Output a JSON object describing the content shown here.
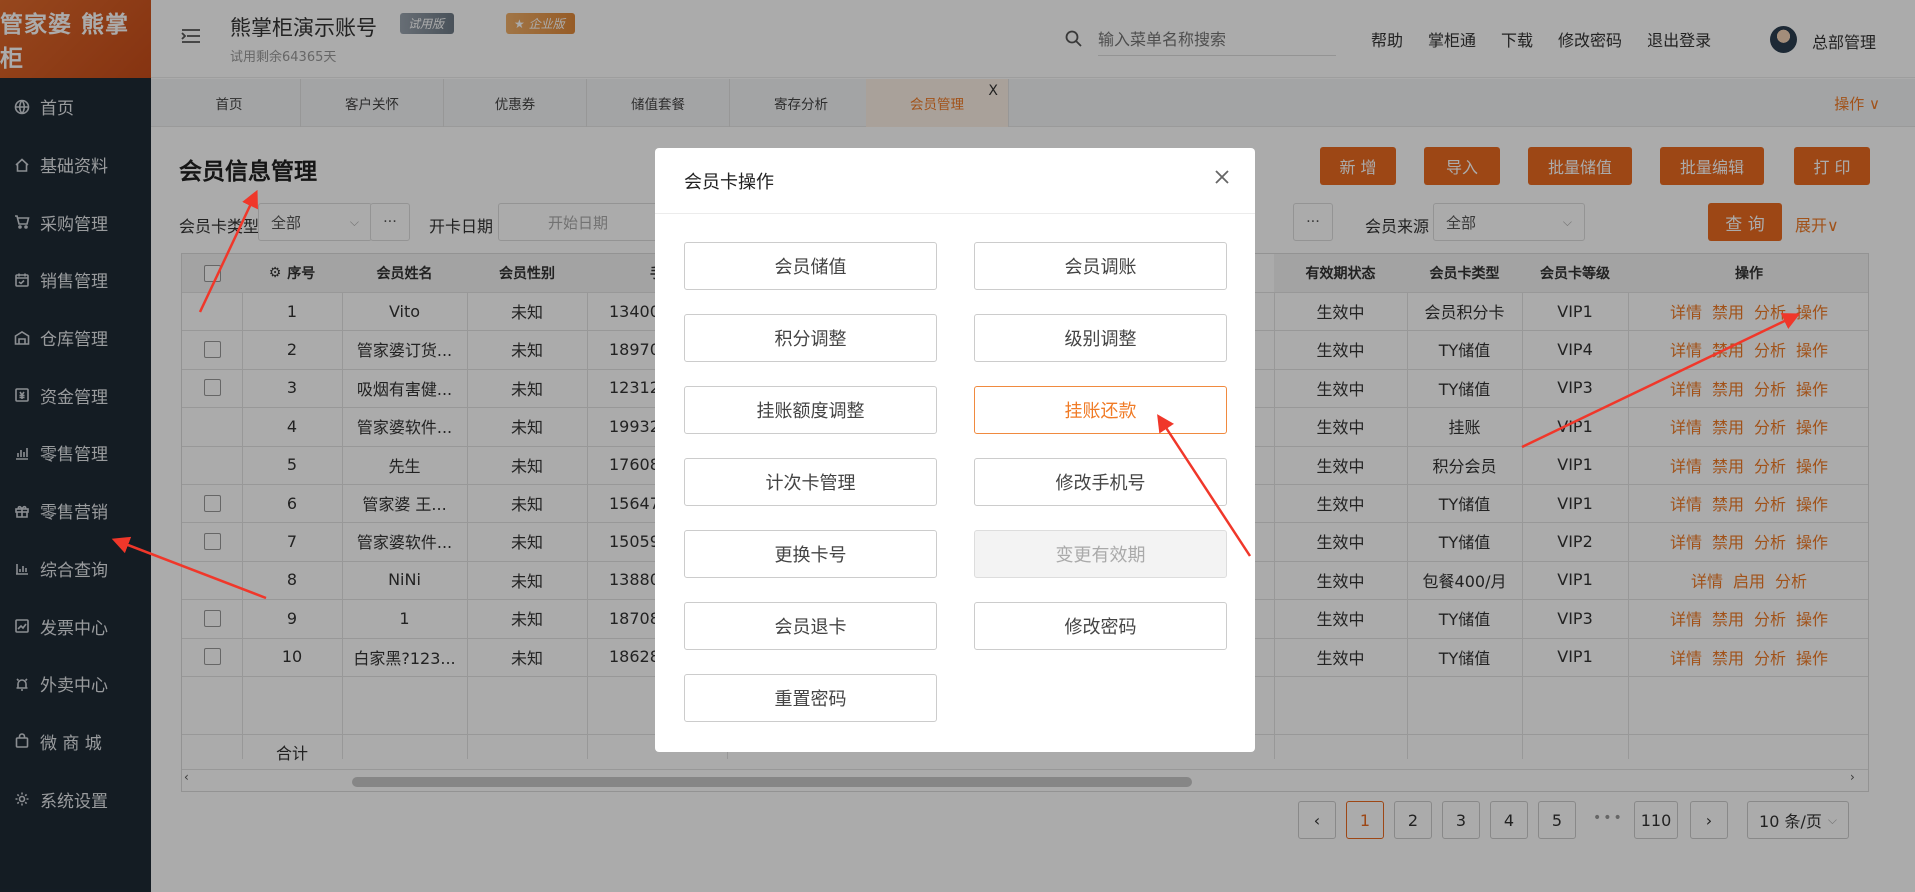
{
  "sidebar": {
    "logo": "管家婆 熊掌柜",
    "items": [
      {
        "label": "首页",
        "icon": "globe-icon"
      },
      {
        "label": "基础资料",
        "icon": "home-icon"
      },
      {
        "label": "采购管理",
        "icon": "cart-icon"
      },
      {
        "label": "销售管理",
        "icon": "calendar-icon"
      },
      {
        "label": "仓库管理",
        "icon": "warehouse-icon"
      },
      {
        "label": "资金管理",
        "icon": "money-icon"
      },
      {
        "label": "零售管理",
        "icon": "bar-chart-icon"
      },
      {
        "label": "零售营销",
        "icon": "gift-icon"
      },
      {
        "label": "综合查询",
        "icon": "stats-icon"
      },
      {
        "label": "发票中心",
        "icon": "line-chart-icon"
      },
      {
        "label": "外卖中心",
        "icon": "alarm-icon"
      },
      {
        "label": "微 商 城",
        "icon": "bag-icon"
      },
      {
        "label": "系统设置",
        "icon": "gear-icon"
      }
    ]
  },
  "header": {
    "title": "熊掌柜演示账号",
    "subtitle": "试用剩余64365天",
    "badge_trial": "试用版",
    "badge_enterprise": "企业版",
    "search_placeholder": "输入菜单名称搜索",
    "links": [
      "帮助",
      "掌柜通",
      "下载",
      "修改密码",
      "退出登录"
    ],
    "user": "总部管理"
  },
  "tabs": {
    "items": [
      "首页",
      "客户关怀",
      "优惠券",
      "储值套餐",
      "寄存分析",
      "会员管理"
    ],
    "active_index": 5,
    "close": "X",
    "operate": "操作 ∨"
  },
  "page": {
    "title": "会员信息管理",
    "buttons": [
      "新 增",
      "导入",
      "批量储值",
      "批量编辑",
      "打 印"
    ],
    "filters": {
      "card_type_label": "会员卡类型",
      "card_type_value": "全部",
      "open_date_label": "开卡日期",
      "start_date_placeholder": "开始日期",
      "source_label": "会员来源",
      "source_value": "全部",
      "more": "···"
    },
    "query": "查 询",
    "expand": "展开∨"
  },
  "table": {
    "headers": {
      "index": "序号",
      "name": "会员姓名",
      "gender": "会员性别",
      "phone": "手",
      "status": "有效期状态",
      "card_type": "会员卡类型",
      "level": "会员卡等级",
      "ops": "操作"
    },
    "rows": [
      {
        "no": "1",
        "name": "Vito",
        "gender": "未知",
        "phone": "13400",
        "status": "生效中",
        "type": "会员积分卡",
        "level": "VIP1",
        "checkbox": false,
        "disabled": false
      },
      {
        "no": "2",
        "name": "管家婆订货...",
        "gender": "未知",
        "phone": "18970",
        "status": "生效中",
        "type": "TY储值",
        "level": "VIP4",
        "checkbox": true,
        "disabled": false
      },
      {
        "no": "3",
        "name": "吸烟有害健...",
        "gender": "未知",
        "phone": "12312",
        "status": "生效中",
        "type": "TY储值",
        "level": "VIP3",
        "checkbox": true,
        "disabled": false
      },
      {
        "no": "4",
        "name": "管家婆软件...",
        "gender": "未知",
        "phone": "19932",
        "status": "生效中",
        "type": "挂账",
        "level": "VIP1",
        "checkbox": false,
        "disabled": false
      },
      {
        "no": "5",
        "name": "先生",
        "gender": "未知",
        "phone": "17608",
        "status": "生效中",
        "type": "积分会员",
        "level": "VIP1",
        "checkbox": false,
        "disabled": false
      },
      {
        "no": "6",
        "name": "管家婆 王...",
        "gender": "未知",
        "phone": "15647",
        "status": "生效中",
        "type": "TY储值",
        "level": "VIP1",
        "checkbox": true,
        "disabled": false
      },
      {
        "no": "7",
        "name": "管家婆软件...",
        "gender": "未知",
        "phone": "15059",
        "status": "生效中",
        "type": "TY储值",
        "level": "VIP2",
        "checkbox": true,
        "disabled": false
      },
      {
        "no": "8",
        "name": "NiNi",
        "gender": "未知",
        "phone": "13880",
        "status": "生效中",
        "type": "包餐400/月",
        "level": "VIP1",
        "checkbox": false,
        "disabled": true
      },
      {
        "no": "9",
        "name": "1",
        "gender": "未知",
        "phone": "18708",
        "status": "生效中",
        "type": "TY储值",
        "level": "VIP3",
        "checkbox": true,
        "disabled": false
      },
      {
        "no": "10",
        "name": "白家黑?123...",
        "gender": "未知",
        "phone": "18628",
        "status": "生效中",
        "type": "TY储值",
        "level": "VIP1",
        "checkbox": true,
        "disabled": false
      }
    ],
    "actions": [
      "详情",
      "禁用",
      "分析",
      "操作"
    ],
    "actions_disabled": [
      "详情",
      "启用",
      "分析"
    ],
    "total_label": "合计"
  },
  "pagination": {
    "pages": [
      "1",
      "2",
      "3",
      "4",
      "5"
    ],
    "ellipsis": "•••",
    "last": "110",
    "page_size": "10 条/页",
    "prev": "‹",
    "next": "›"
  },
  "modal": {
    "title": "会员卡操作",
    "buttons": [
      "会员储值",
      "会员调账",
      "积分调整",
      "级别调整",
      "挂账额度调整",
      "挂账还款",
      "计次卡管理",
      "修改手机号",
      "更换卡号",
      "变更有效期",
      "会员退卡",
      "修改密码",
      "重置密码"
    ],
    "highlight_index": 5,
    "disabled_index": 9
  },
  "colors": {
    "accent": "#ea6a20",
    "sidebar": "#1f2a35",
    "arrow": "#f0372a"
  }
}
